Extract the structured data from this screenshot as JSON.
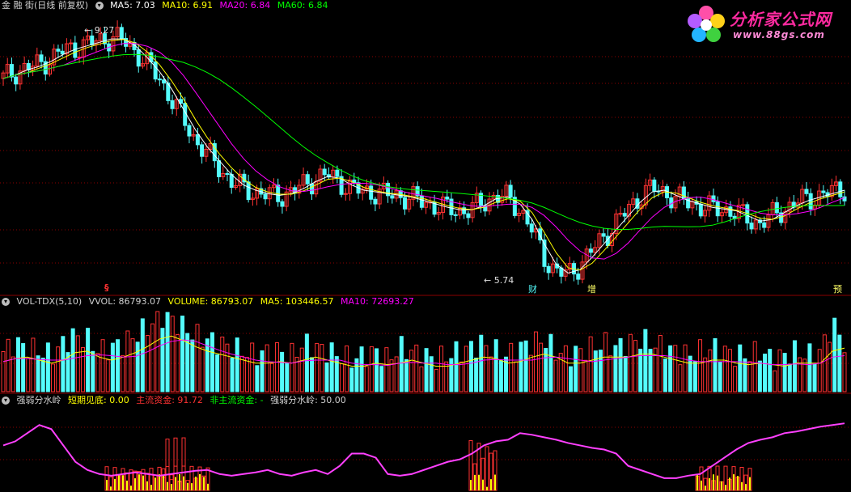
{
  "colors": {
    "background": "#000000",
    "divider": "#8b0000",
    "up": "#ff3232",
    "down": "#54fcfc",
    "ma5": "#ffffff",
    "ma10": "#ffff00",
    "ma20": "#ff00ff",
    "ma60": "#00ff00",
    "grid": "#8b0000"
  },
  "main_header": {
    "stock_name": "金 融 街(日线 前复权)",
    "indicator_icon": "circle-chevron-icon",
    "ma5": "MA5: 7.03",
    "ma10": "MA10: 6.91",
    "ma20": "MA20: 6.84",
    "ma60": "MA60: 6.84"
  },
  "logo": {
    "title": "分析家公式网",
    "url": "www.88gs.com",
    "icon": "flower-logo-icon"
  },
  "price_labels": {
    "high": "9.27",
    "low": "5.74"
  },
  "event_markers": [
    {
      "text": "§",
      "color": "#ff3232"
    },
    {
      "text": "财",
      "color": "#54fcfc"
    },
    {
      "text": "增",
      "color": "#ffff66"
    },
    {
      "text": "预",
      "color": "#ffff66"
    }
  ],
  "volume_header": {
    "name": "VOL-TDX(5,10)",
    "vvol": "VVOL: 86793.07",
    "volume": "VOLUME: 86793.07",
    "ma5": "MA5: 103446.57",
    "ma10": "MA10: 72693.27"
  },
  "indicator_header": {
    "name": "强弱分水岭",
    "short_bottom": "短期见底: 0.00",
    "main_fund": "主流资金: 91.72",
    "non_main_fund": "非主流资金: -",
    "watershed": "强弱分水岭: 50.00"
  },
  "chart_data": {
    "type": "candlestick",
    "series": [
      {
        "name": "MA5"
      },
      {
        "name": "MA10"
      },
      {
        "name": "MA20"
      },
      {
        "name": "MA60"
      }
    ],
    "price_high": 9.27,
    "price_low": 5.74,
    "close_trend": [
      8.6,
      8.7,
      8.75,
      8.8,
      8.9,
      9.0,
      9.05,
      9.1,
      9.15,
      9.2,
      9.15,
      9.0,
      8.8,
      8.6,
      8.3,
      8.0,
      7.7,
      7.5,
      7.3,
      7.1,
      7.0,
      6.95,
      6.9,
      6.9,
      6.95,
      7.05,
      7.15,
      7.2,
      7.1,
      7.0,
      6.95,
      6.95,
      6.9,
      6.9,
      6.85,
      6.8,
      6.75,
      6.7,
      6.68,
      6.7,
      6.8,
      6.9,
      6.85,
      6.7,
      6.4,
      6.0,
      5.8,
      5.74,
      5.9,
      6.1,
      6.3,
      6.5,
      6.7,
      6.9,
      7.0,
      6.95,
      6.85,
      6.8,
      6.75,
      6.7,
      6.7,
      6.65,
      6.55,
      6.5,
      6.6,
      6.7,
      6.8,
      6.85,
      6.9,
      6.95,
      7.0
    ],
    "volume_trend": [
      0.5,
      0.6,
      0.55,
      0.5,
      0.45,
      0.6,
      0.7,
      0.65,
      0.5,
      0.55,
      0.6,
      0.7,
      0.8,
      0.95,
      0.9,
      0.8,
      0.7,
      0.65,
      0.6,
      0.55,
      0.5,
      0.45,
      0.5,
      0.5,
      0.45,
      0.6,
      0.55,
      0.5,
      0.45,
      0.4,
      0.45,
      0.5,
      0.4,
      0.55,
      0.5,
      0.45,
      0.4,
      0.45,
      0.5,
      0.55,
      0.6,
      0.5,
      0.45,
      0.55,
      0.6,
      0.65,
      0.5,
      0.45,
      0.5,
      0.55,
      0.6,
      0.55,
      0.6,
      0.65,
      0.6,
      0.55,
      0.5,
      0.45,
      0.5,
      0.55,
      0.5,
      0.45,
      0.45,
      0.5,
      0.4,
      0.45,
      0.5,
      0.45,
      0.5,
      0.85,
      0.6
    ],
    "watershed_line": [
      55,
      60,
      70,
      80,
      75,
      55,
      35,
      25,
      20,
      18,
      20,
      22,
      20,
      18,
      20,
      22,
      24,
      25,
      20,
      18,
      20,
      22,
      25,
      20,
      18,
      22,
      25,
      20,
      30,
      45,
      45,
      40,
      20,
      18,
      20,
      25,
      30,
      35,
      38,
      45,
      55,
      60,
      62,
      70,
      68,
      65,
      62,
      58,
      55,
      52,
      50,
      45,
      30,
      25,
      20,
      15,
      15,
      18,
      20,
      30,
      40,
      50,
      58,
      62,
      65,
      70,
      72,
      75,
      78,
      80,
      82
    ]
  }
}
